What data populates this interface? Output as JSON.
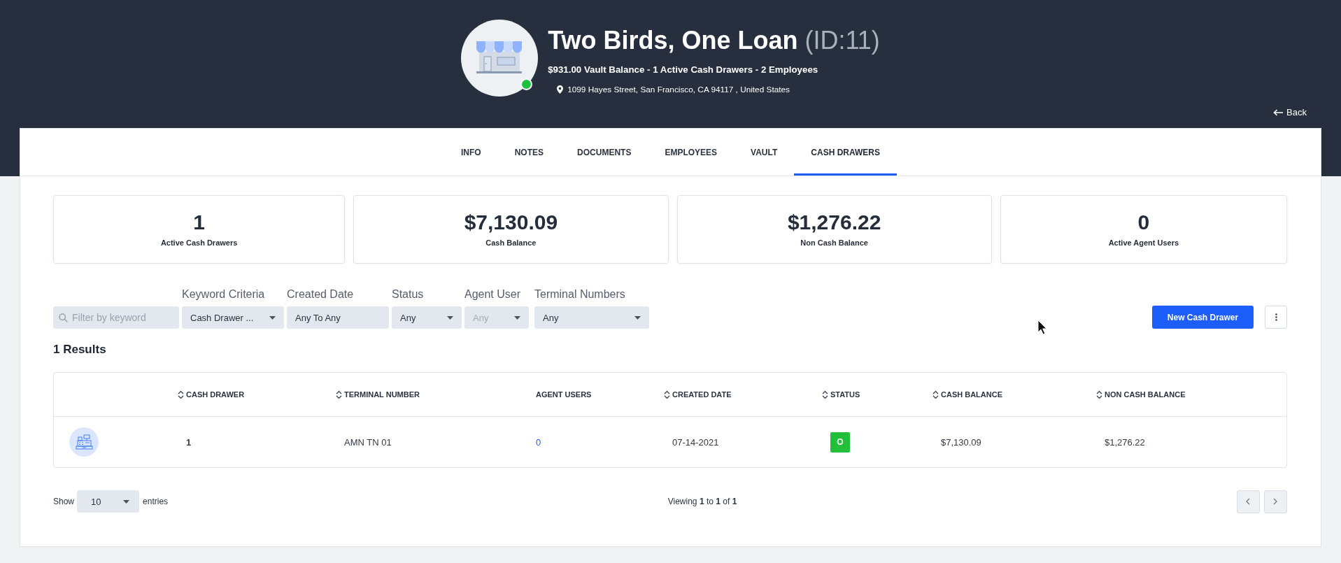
{
  "header": {
    "store_name": "Two Birds, One Loan",
    "store_id": "(ID:11)",
    "online": true,
    "summary": "$931.00 Vault Balance - 1 Active Cash Drawers - 2 Employees",
    "address": "1099 Hayes Street, San Francisco, CA 94117 , United States",
    "back_link": "Back"
  },
  "tabs": [
    {
      "label": "INFO",
      "selected": false
    },
    {
      "label": "NOTES",
      "selected": false
    },
    {
      "label": "DOCUMENTS",
      "selected": false
    },
    {
      "label": "EMPLOYEES",
      "selected": false
    },
    {
      "label": "VAULT",
      "selected": false
    },
    {
      "label": "CASH DRAWERS",
      "selected": true
    }
  ],
  "stats": [
    {
      "value": "1",
      "label": "Active Cash Drawers"
    },
    {
      "value": "$7,130.09",
      "label": "Cash Balance"
    },
    {
      "value": "$1,276.22",
      "label": "Non Cash Balance"
    },
    {
      "value": "0",
      "label": "Active Agent Users"
    }
  ],
  "filters": {
    "search": {
      "placeholder": "Filter by keyword"
    },
    "fields": [
      {
        "label": "Keyword Criteria",
        "value": "Cash Drawer ...",
        "kind": "dropdown",
        "disabled": false
      },
      {
        "label": "Created Date",
        "value": "Any To Any",
        "kind": "range",
        "disabled": false
      },
      {
        "label": "Status",
        "value": "Any",
        "kind": "dropdown",
        "disabled": false
      },
      {
        "label": "Agent User",
        "value": "Any",
        "kind": "dropdown",
        "disabled": true
      },
      {
        "label": "Terminal Numbers",
        "value": "Any",
        "kind": "dropdown",
        "disabled": false
      }
    ]
  },
  "toolbar": {
    "new_button": "New Cash Drawer"
  },
  "results_count": "1 Results",
  "table": {
    "columns": [
      {
        "label": "CASH DRAWER",
        "sortable": true
      },
      {
        "label": "TERMINAL NUMBER",
        "sortable": true
      },
      {
        "label": "AGENT USERS",
        "sortable": false
      },
      {
        "label": "CREATED DATE",
        "sortable": true
      },
      {
        "label": "STATUS",
        "sortable": true
      },
      {
        "label": "CASH BALANCE",
        "sortable": true
      },
      {
        "label": "NON CASH BALANCE",
        "sortable": true
      }
    ],
    "rows": [
      {
        "cells": [
          {
            "kind": "strong",
            "text": "1"
          },
          {
            "kind": "text",
            "text": "AMN TN 01"
          },
          {
            "kind": "link",
            "text": "0"
          },
          {
            "kind": "text",
            "text": "07-14-2021"
          },
          {
            "kind": "badge",
            "text": "O",
            "color": "#22bf3a"
          },
          {
            "kind": "text",
            "text": "$7,130.09"
          },
          {
            "kind": "text",
            "text": "$1,276.22"
          }
        ]
      }
    ]
  },
  "pagination": {
    "show_label": "Show",
    "page_size": "10",
    "entries_label": "entries",
    "summary": "Viewing **1** to **1** of **1**"
  }
}
